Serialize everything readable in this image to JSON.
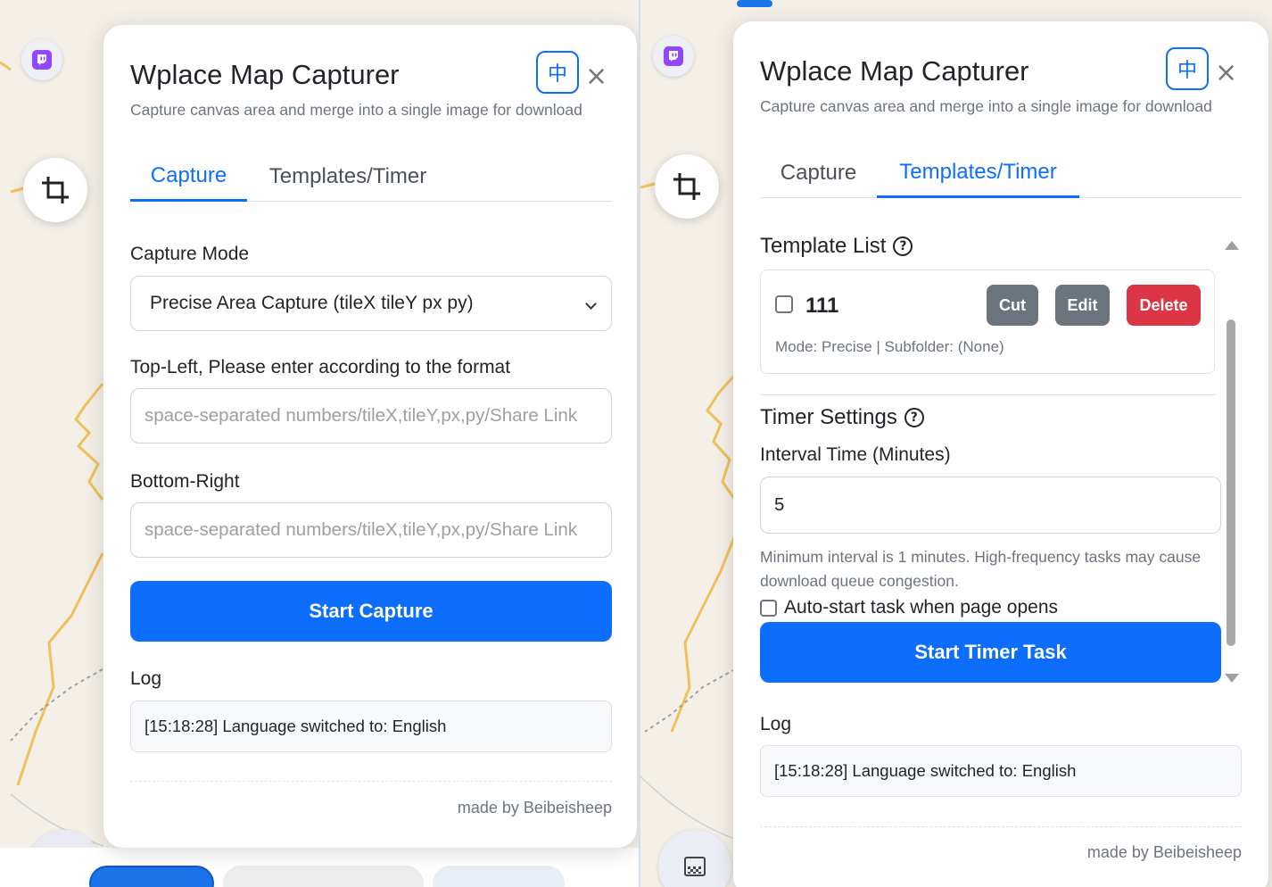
{
  "left": {
    "title": "Wplace Map Capturer",
    "subtitle": "Capture canvas area and merge into a single image for download",
    "lang_button": "中",
    "close_glyph": "×",
    "tabs": [
      "Capture",
      "Templates/Timer"
    ],
    "active_tab": "Capture",
    "capture_mode_label": "Capture Mode",
    "capture_mode_value": "Precise Area Capture (tileX tileY px py)",
    "top_left_label": "Top-Left, Please enter according to the format",
    "top_left_placeholder": "space-separated numbers/tileX,tileY,px,py/Share Link",
    "bottom_right_label": "Bottom-Right",
    "bottom_right_placeholder": "space-separated numbers/tileX,tileY,px,py/Share Link",
    "start_button": "Start Capture",
    "log_label": "Log",
    "log_entry": "[15:18:28] Language switched to: English",
    "footer": "made by Beibeisheep"
  },
  "right": {
    "title": "Wplace Map Capturer",
    "subtitle": "Capture canvas area and merge into a single image for download",
    "lang_button": "中",
    "close_glyph": "×",
    "tabs": [
      "Capture",
      "Templates/Timer"
    ],
    "active_tab": "Templates/Timer",
    "template_list_label": "Template List",
    "help_glyph": "?",
    "template": {
      "name": "111",
      "meta": "Mode: Precise | Subfolder: (None)",
      "cut_label": "Cut",
      "edit_label": "Edit",
      "delete_label": "Delete"
    },
    "timer_settings_label": "Timer Settings",
    "interval_label": "Interval Time (Minutes)",
    "interval_value": "5",
    "interval_hint": "Minimum interval is 1 minutes. High-frequency tasks may cause download queue congestion.",
    "auto_start_label": "Auto-start task when page opens",
    "start_timer_button": "Start Timer Task",
    "log_label": "Log",
    "log_entry": "[15:18:28] Language switched to: English",
    "footer": "made by Beibeisheep"
  },
  "colors": {
    "primary": "#0d6efd",
    "danger": "#dc3545",
    "secondary": "#6c757d",
    "twitch": "#9146ff"
  },
  "icons": [
    "twitch-icon",
    "crop-icon",
    "grid-icon",
    "chevron-down-icon",
    "close-icon",
    "help-icon"
  ]
}
